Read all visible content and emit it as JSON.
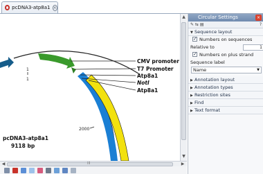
{
  "tab": {
    "title": "pcDNA3-atp8a1"
  },
  "map": {
    "name": "pcDNA3-atp8a1",
    "length": "9118 bp",
    "tick_small": "1",
    "tick_small2": "1",
    "tick_2000": "2000",
    "features": [
      {
        "label": "CMV promoter"
      },
      {
        "label": "T7 Promoter"
      },
      {
        "label": "Atp8a1"
      },
      {
        "label": "NotI"
      },
      {
        "label": "Atp8a1"
      }
    ],
    "colors": {
      "cmv": "#3a9a2c",
      "t7": "#2f7f24",
      "atp_blue": "#1a7fd4",
      "atp_yellow": "#f2e10e",
      "arrow_left": "#155c8a"
    }
  },
  "panel": {
    "title": "Circular Settings",
    "help": "?",
    "sections": {
      "sequence_layout": "Sequence layout",
      "numbers_on_sequences": "Numbers on sequences",
      "relative_to": "Relative to",
      "relative_value": "1",
      "numbers_plus_strand": "Numbers on plus strand",
      "sequence_label": "Sequence label",
      "sequence_label_value": "Name",
      "annotation_layout": "Annotation layout",
      "annotation_types": "Annotation types",
      "restriction_sites": "Restriction sites",
      "find": "Find",
      "text_format": "Text format"
    }
  },
  "scroll": {
    "grip": "III"
  }
}
